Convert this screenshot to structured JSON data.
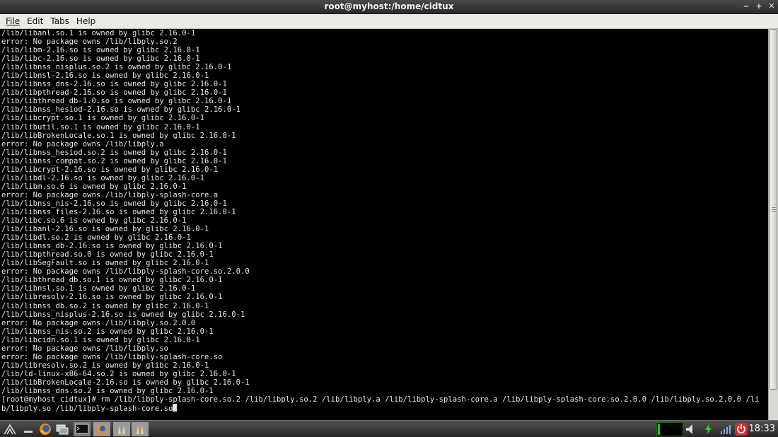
{
  "window": {
    "title": "root@myhost:/home/cidtux"
  },
  "menu": {
    "file": "File",
    "edit": "Edit",
    "tabs": "Tabs",
    "help": "Help"
  },
  "terminal": {
    "lines": [
      "/lib/libanl.so.1 is owned by glibc 2.16.0-1",
      "error: No package owns /lib/libply.so.2",
      "/lib/libm-2.16.so is owned by glibc 2.16.0-1",
      "/lib/libc-2.16.so is owned by glibc 2.16.0-1",
      "/lib/libnss_nisplus.so.2 is owned by glibc 2.16.0-1",
      "/lib/libnsl-2.16.so is owned by glibc 2.16.0-1",
      "/lib/libnss_dns-2.16.so is owned by glibc 2.16.0-1",
      "/lib/libpthread-2.16.so is owned by glibc 2.16.0-1",
      "/lib/libthread_db-1.0.so is owned by glibc 2.16.0-1",
      "/lib/libnss_hesiod-2.16.so is owned by glibc 2.16.0-1",
      "/lib/libcrypt.so.1 is owned by glibc 2.16.0-1",
      "/lib/libutil.so.1 is owned by glibc 2.16.0-1",
      "/lib/libBrokenLocale.so.1 is owned by glibc 2.16.0-1",
      "error: No package owns /lib/libply.a",
      "/lib/libnss_hesiod.so.2 is owned by glibc 2.16.0-1",
      "/lib/libnss_compat.so.2 is owned by glibc 2.16.0-1",
      "/lib/libcrypt-2.16.so is owned by glibc 2.16.0-1",
      "/lib/libdl-2.16.so is owned by glibc 2.16.0-1",
      "/lib/libm.so.6 is owned by glibc 2.16.0-1",
      "error: No package owns /lib/libply-splash-core.a",
      "/lib/libnss_nis-2.16.so is owned by glibc 2.16.0-1",
      "/lib/libnss_files-2.16.so is owned by glibc 2.16.0-1",
      "/lib/libc.so.6 is owned by glibc 2.16.0-1",
      "/lib/libanl-2.16.so is owned by glibc 2.16.0-1",
      "/lib/libdl.so.2 is owned by glibc 2.16.0-1",
      "/lib/libnss_db-2.16.so is owned by glibc 2.16.0-1",
      "/lib/libpthread.so.0 is owned by glibc 2.16.0-1",
      "/lib/libSegFault.so is owned by glibc 2.16.0-1",
      "error: No package owns /lib/libply-splash-core.so.2.0.0",
      "/lib/libthread_db.so.1 is owned by glibc 2.16.0-1",
      "/lib/libnsl.so.1 is owned by glibc 2.16.0-1",
      "/lib/libresolv-2.16.so is owned by glibc 2.16.0-1",
      "/lib/libnss_db.so.2 is owned by glibc 2.16.0-1",
      "/lib/libnss_nisplus-2.16.so is owned by glibc 2.16.0-1",
      "error: No package owns /lib/libply.so.2.0.0",
      "/lib/libnss_nis.so.2 is owned by glibc 2.16.0-1",
      "/lib/libcidn.so.1 is owned by glibc 2.16.0-1",
      "error: No package owns /lib/libply.so",
      "error: No package owns /lib/libply-splash-core.so",
      "/lib/libresolv.so.2 is owned by glibc 2.16.0-1",
      "/lib/ld-linux-x86-64.so.2 is owned by glibc 2.16.0-1",
      "/lib/libBrokenLocale-2.16.so is owned by glibc 2.16.0-1",
      "/lib/libnss_dns.so.2 is owned by glibc 2.16.0-1",
      "[root@myhost cidtux]# rm /lib/libply-splash-core.so.2 /lib/libply.so.2 /lib/libply.a /lib/libply-splash-core.a /lib/libply-splash-core.so.2.0.0 /lib/libply.so.2.0.0 /li",
      "b/libply.so /lib/libply-splash-core.so"
    ]
  },
  "taskbar": {
    "clock": "18:33"
  },
  "colors": {
    "accent_green": "#22c41c",
    "power_red": "#d62b2b"
  }
}
